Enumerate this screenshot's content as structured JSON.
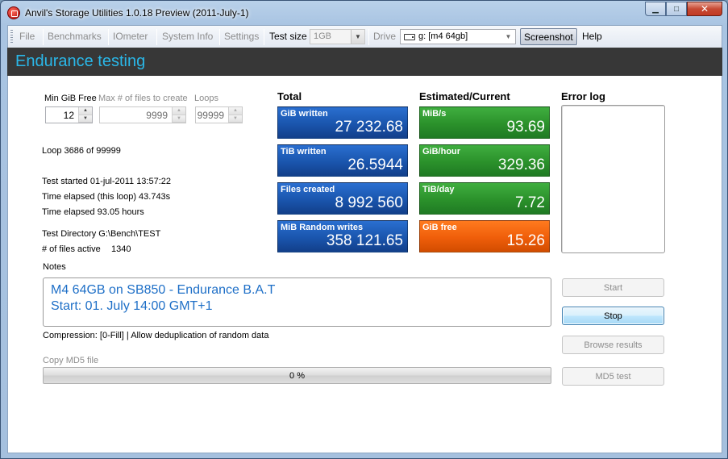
{
  "window": {
    "title": "Anvil's Storage Utilities 1.0.18 Preview (2011-July-1)",
    "min_glyph": "▁",
    "max_glyph": "□",
    "close_glyph": "✕"
  },
  "menu": {
    "file": "File",
    "benchmarks": "Benchmarks",
    "iometer": "IOmeter",
    "system_info": "System Info",
    "settings": "Settings",
    "test_size_label": "Test size",
    "test_size_value": "1GB",
    "drive_label": "Drive",
    "drive_value": "g: [m4 64gb]",
    "screenshot": "Screenshot",
    "help": "Help"
  },
  "header": {
    "title": "Endurance testing"
  },
  "params": {
    "min_gib_free_label": "Min GiB Free",
    "min_gib_free_value": "12",
    "max_files_label": "Max # of files to create",
    "max_files_value": "9999",
    "loops_label": "Loops",
    "loops_value": "99999",
    "spin_up": "▲",
    "spin_down": "▼"
  },
  "status": {
    "loop": "Loop 3686 of 99999",
    "test_started": "Test started 01-jul-2011 13:57:22",
    "elapsed_loop": "Time elapsed (this loop) 43.743s",
    "elapsed_total": "Time elapsed 93.05 hours",
    "test_directory": "Test Directory G:\\Bench\\TEST",
    "files_active_label": "# of files active",
    "files_active_value": "1340"
  },
  "totals": {
    "heading": "Total",
    "tiles": [
      {
        "label": "GiB written",
        "value": "27 232.68"
      },
      {
        "label": "TiB written",
        "value": "26.5944"
      },
      {
        "label": "Files created",
        "value": "8 992 560"
      },
      {
        "label": "MiB Random writes",
        "value": "358 121.65"
      }
    ]
  },
  "estimated": {
    "heading": "Estimated/Current",
    "tiles": [
      {
        "label": "MiB/s",
        "value": "93.69"
      },
      {
        "label": "GiB/hour",
        "value": "329.36"
      },
      {
        "label": "TiB/day",
        "value": "7.72"
      },
      {
        "label": "GiB free",
        "value": "15.26"
      }
    ]
  },
  "error_log": {
    "heading": "Error log"
  },
  "notes": {
    "label": "Notes",
    "line1": "M4 64GB on SB850 - Endurance B.A.T",
    "line2": "Start: 01. July 14:00 GMT+1"
  },
  "compression": "Compression: [0-Fill] | Allow deduplication of random data",
  "md5": {
    "label": "Copy MD5 file",
    "progress_text": "0 %",
    "progress": 0
  },
  "buttons": {
    "start": "Start",
    "stop": "Stop",
    "browse": "Browse results",
    "md5_test": "MD5 test"
  },
  "colors": {
    "header_accent": "#2ab7e8",
    "tile_blue": "#1a55ad",
    "tile_green": "#2b912b",
    "tile_orange": "#ef5e0a",
    "notes_text": "#1e6fc7"
  }
}
